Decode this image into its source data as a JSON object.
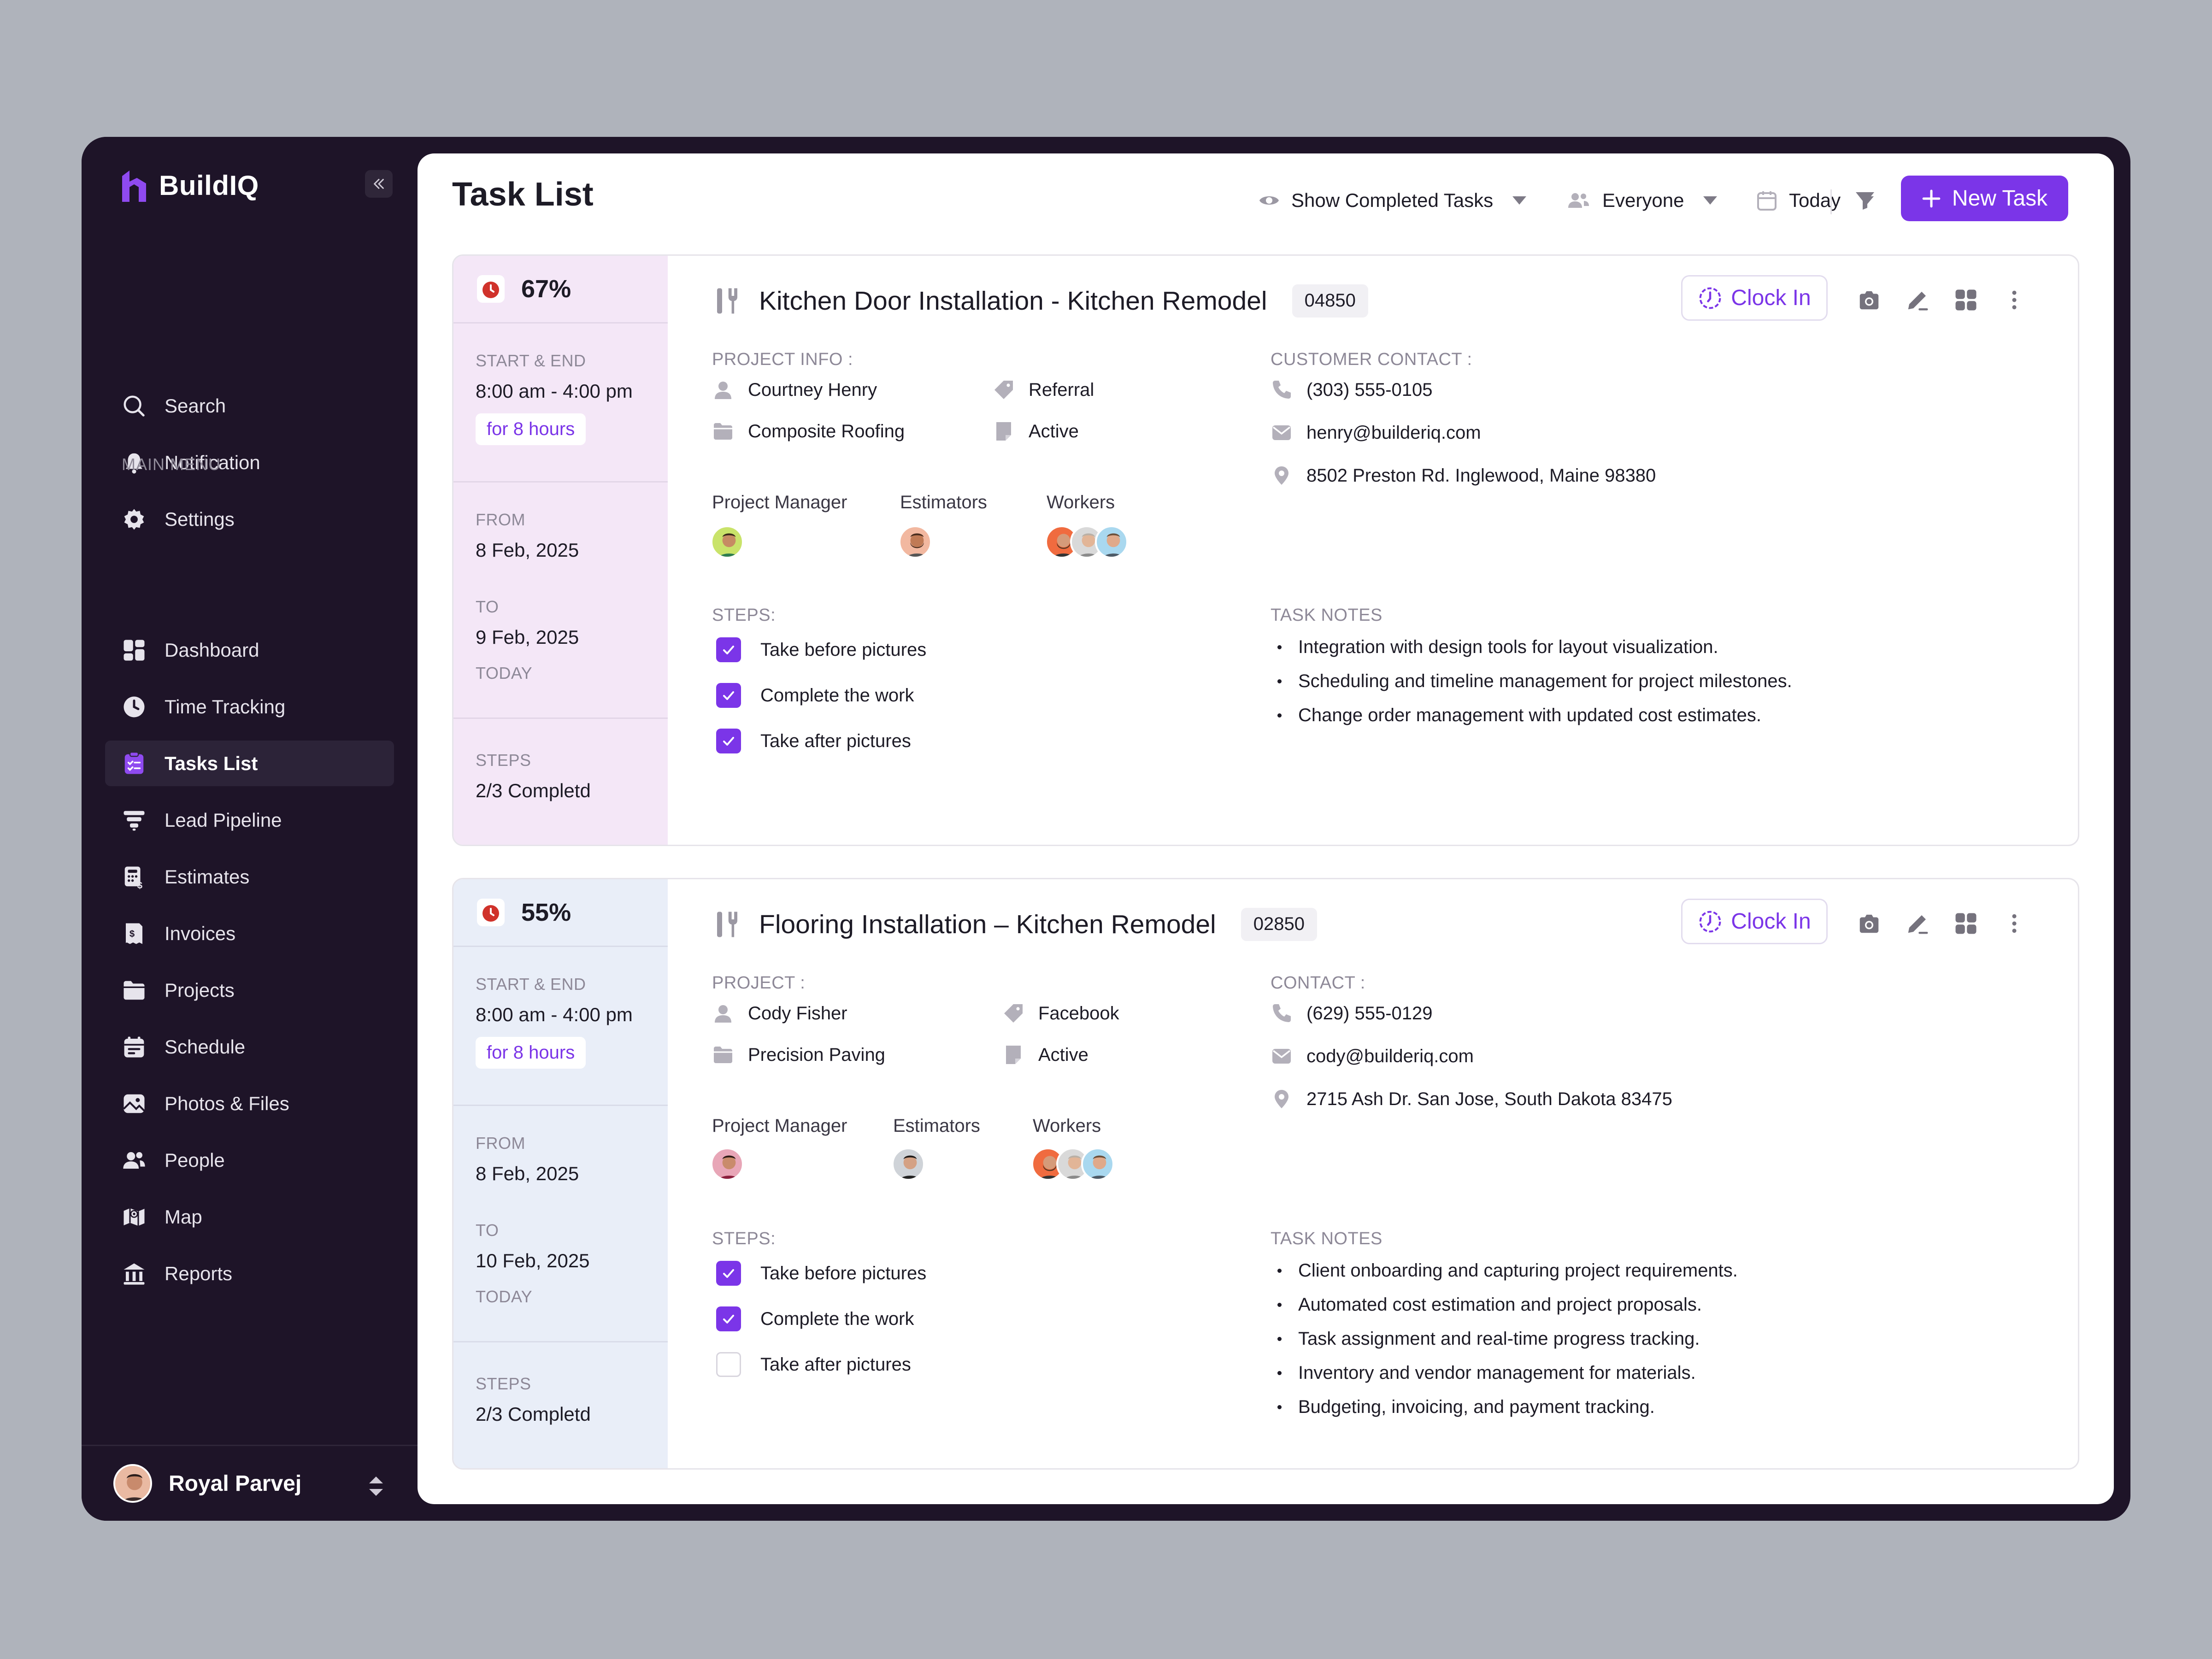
{
  "app": {
    "brand_name": "BuildIQ",
    "brand_color": "#7b35e8"
  },
  "sidebar": {
    "top_items": [
      {
        "label": "Search",
        "icon": "search-icon"
      },
      {
        "label": "Notification",
        "icon": "bell-icon"
      },
      {
        "label": "Settings",
        "icon": "gear-icon"
      }
    ],
    "menu_heading": "MAIN MENU",
    "items": [
      {
        "label": "Dashboard",
        "icon": "dashboard-icon"
      },
      {
        "label": "Time Tracking",
        "icon": "clock-icon"
      },
      {
        "label": "Tasks List",
        "icon": "tasks-icon",
        "active": true
      },
      {
        "label": "Lead Pipeline",
        "icon": "funnel-icon"
      },
      {
        "label": "Estimates",
        "icon": "estimate-icon"
      },
      {
        "label": "Invoices",
        "icon": "invoice-icon"
      },
      {
        "label": "Projects",
        "icon": "folder-icon"
      },
      {
        "label": "Schedule",
        "icon": "calendar-icon"
      },
      {
        "label": "Photos & Files",
        "icon": "photos-icon"
      },
      {
        "label": "People",
        "icon": "people-icon"
      },
      {
        "label": "Map",
        "icon": "map-icon"
      },
      {
        "label": "Reports",
        "icon": "reports-icon"
      }
    ],
    "user": {
      "name": "Royal Parvej"
    }
  },
  "header": {
    "title": "Task List",
    "show_completed": "Show Completed Tasks",
    "assignee_filter": "Everyone",
    "date_filter": "Today",
    "new_task_label": "New Task"
  },
  "tasks": [
    {
      "percent": "67%",
      "start_end_label": "START & END",
      "time_range": "8:00 am - 4:00 pm",
      "duration": "for 8 hours",
      "from_label": "FROM",
      "from_date": "8 Feb, 2025",
      "to_label": "TO",
      "to_date": "9 Feb, 2025",
      "to_note": "TODAY",
      "steps_label": "STEPS",
      "steps_summary": "2/3 Completd",
      "title": "Kitchen Door Installation - Kitchen Remodel",
      "code": "04850",
      "clock_in_label": "Clock In",
      "project_label": "PROJECT INFO :",
      "client": "Courtney Henry",
      "company": "Composite Roofing",
      "source": "Referral",
      "status": "Active",
      "contact_label": "CUSTOMER CONTACT :",
      "phone": "(303) 555-0105",
      "email": "henry@builderiq.com",
      "address": "8502 Preston Rd. Inglewood, Maine 98380",
      "pm_label": "Project Manager",
      "est_label": "Estimators",
      "workers_label": "Workers",
      "steps_heading": "STEPS:",
      "steps": [
        {
          "label": "Take before pictures",
          "done": true
        },
        {
          "label": "Complete the work",
          "done": true
        },
        {
          "label": "Take after pictures",
          "done": true
        }
      ],
      "notes_heading": "TASK NOTES",
      "notes": [
        "Integration with design tools for layout visualization.",
        "Scheduling and timeline management for project milestones.",
        "Change order management with updated cost estimates."
      ]
    },
    {
      "percent": "55%",
      "start_end_label": "START & END",
      "time_range": "8:00 am - 4:00 pm",
      "duration": "for 8 hours",
      "from_label": "FROM",
      "from_date": "8 Feb, 2025",
      "to_label": "TO",
      "to_date": "10 Feb, 2025",
      "to_note": "TODAY",
      "steps_label": "STEPS",
      "steps_summary": "2/3 Completd",
      "title": "Flooring Installation – Kitchen Remodel",
      "code": "02850",
      "clock_in_label": "Clock In",
      "project_label": "PROJECT :",
      "client": "Cody Fisher",
      "company": "Precision Paving",
      "source": "Facebook",
      "status": "Active",
      "contact_label": "CONTACT :",
      "phone": "(629) 555-0129",
      "email": "cody@builderiq.com",
      "address": "2715 Ash Dr. San Jose, South Dakota 83475",
      "pm_label": "Project Manager",
      "est_label": "Estimators",
      "workers_label": "Workers",
      "steps_heading": "STEPS:",
      "steps": [
        {
          "label": "Take before pictures",
          "done": true
        },
        {
          "label": "Complete the work",
          "done": true
        },
        {
          "label": "Take after pictures",
          "done": false
        }
      ],
      "notes_heading": "TASK NOTES",
      "notes": [
        "Client onboarding and capturing project requirements.",
        "Automated cost estimation and project proposals.",
        "Task assignment and real-time progress tracking.",
        "Inventory and vendor management for materials.",
        "Budgeting, invoicing, and payment tracking."
      ]
    }
  ]
}
